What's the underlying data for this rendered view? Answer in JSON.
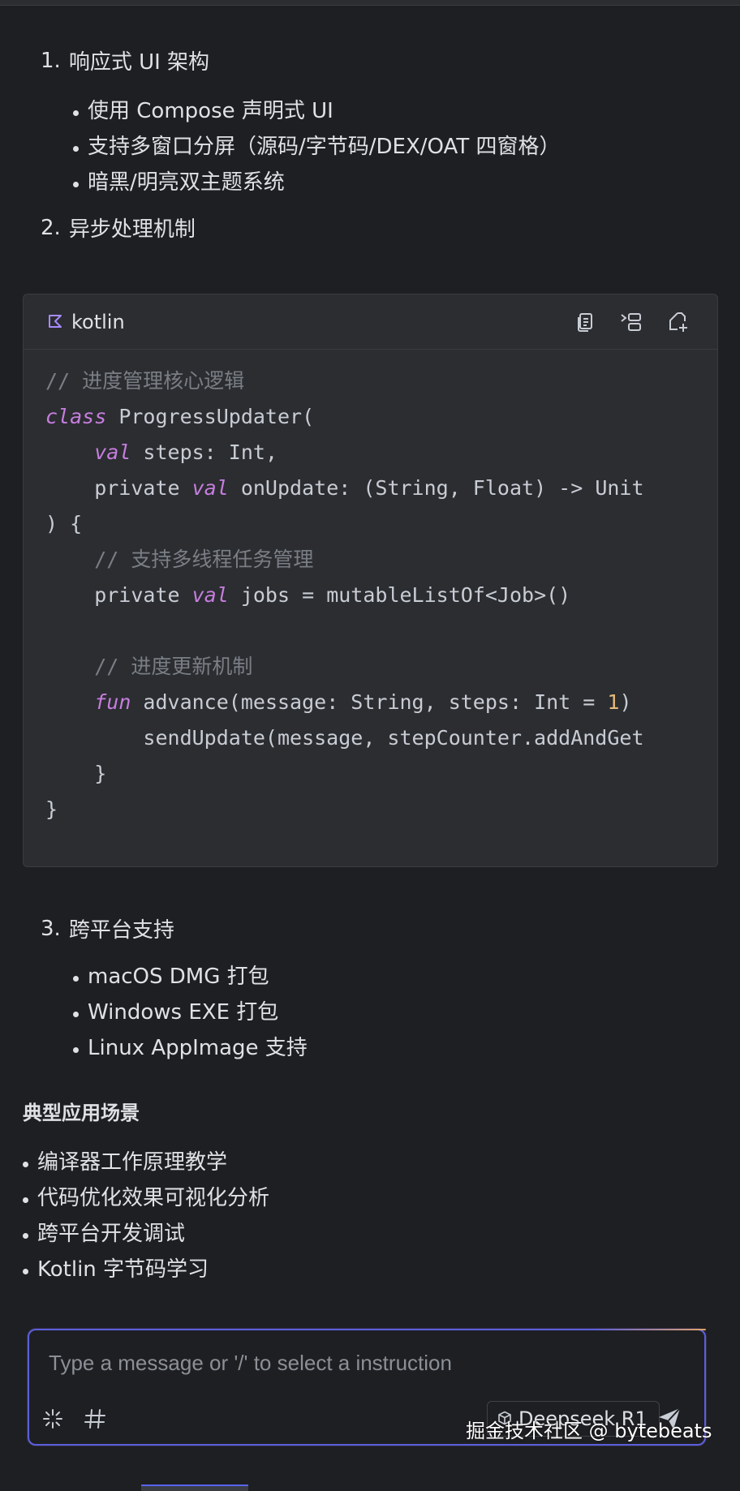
{
  "list1": {
    "num": "1.",
    "title": "响应式 UI 架构",
    "items": [
      "使用 Compose 声明式 UI",
      "支持多窗口分屏（源码/字节码/DEX/OAT 四窗格）",
      "暗黑/明亮双主题系统"
    ]
  },
  "list2": {
    "num": "2.",
    "title": "异步处理机制"
  },
  "code": {
    "language": "kotlin",
    "lines": [
      [
        {
          "t": "// 进度管理核心逻辑",
          "c": "comment"
        }
      ],
      [
        {
          "t": "class",
          "c": "kw"
        },
        {
          "t": " ProgressUpdater(",
          "c": "plain"
        }
      ],
      [
        {
          "t": "    ",
          "c": "plain"
        },
        {
          "t": "val",
          "c": "kw"
        },
        {
          "t": " steps: Int,",
          "c": "plain"
        }
      ],
      [
        {
          "t": "    private ",
          "c": "plain"
        },
        {
          "t": "val",
          "c": "kw"
        },
        {
          "t": " onUpdate: (String, Float) -> Unit",
          "c": "plain"
        }
      ],
      [
        {
          "t": ") {",
          "c": "plain"
        }
      ],
      [
        {
          "t": "    ",
          "c": "plain"
        },
        {
          "t": "// 支持多线程任务管理",
          "c": "comment"
        }
      ],
      [
        {
          "t": "    private ",
          "c": "plain"
        },
        {
          "t": "val",
          "c": "kw"
        },
        {
          "t": " jobs = mutableListOf<Job>()",
          "c": "plain"
        }
      ],
      [
        {
          "t": "",
          "c": "plain"
        }
      ],
      [
        {
          "t": "    ",
          "c": "plain"
        },
        {
          "t": "// 进度更新机制",
          "c": "comment"
        }
      ],
      [
        {
          "t": "    ",
          "c": "plain"
        },
        {
          "t": "fun",
          "c": "kw"
        },
        {
          "t": " advance(message: String, steps: Int = ",
          "c": "plain"
        },
        {
          "t": "1",
          "c": "num"
        },
        {
          "t": ")",
          "c": "plain"
        }
      ],
      [
        {
          "t": "        sendUpdate(message, stepCounter.addAndGet",
          "c": "plain"
        }
      ],
      [
        {
          "t": "    }",
          "c": "plain"
        }
      ],
      [
        {
          "t": "}",
          "c": "plain"
        }
      ]
    ]
  },
  "list3": {
    "num": "3.",
    "title": "跨平台支持",
    "items": [
      "macOS DMG 打包",
      "Windows EXE 打包",
      "Linux AppImage 支持"
    ]
  },
  "section": {
    "heading": "典型应用场景",
    "items": [
      "编译器工作原理教学",
      "代码优化效果可视化分析",
      "跨平台开发调试",
      "Kotlin 字节码学习"
    ]
  },
  "composer": {
    "placeholder": "Type a message or '/' to select a instruction",
    "model": "Deepseek R1"
  },
  "watermark": "掘金技术社区 @ bytebeats",
  "colors": {
    "background": "#1e1f22",
    "code_background": "#2b2d31",
    "keyword": "#c77dde",
    "comment": "#7a7e85",
    "number": "#e5b97a",
    "accent_border": "#5b5fd8"
  },
  "icons": [
    "kotlin-icon",
    "copy-icon",
    "insert-icon",
    "new-file-icon",
    "sparkle-icon",
    "hash-icon",
    "cube-icon",
    "send-icon"
  ]
}
